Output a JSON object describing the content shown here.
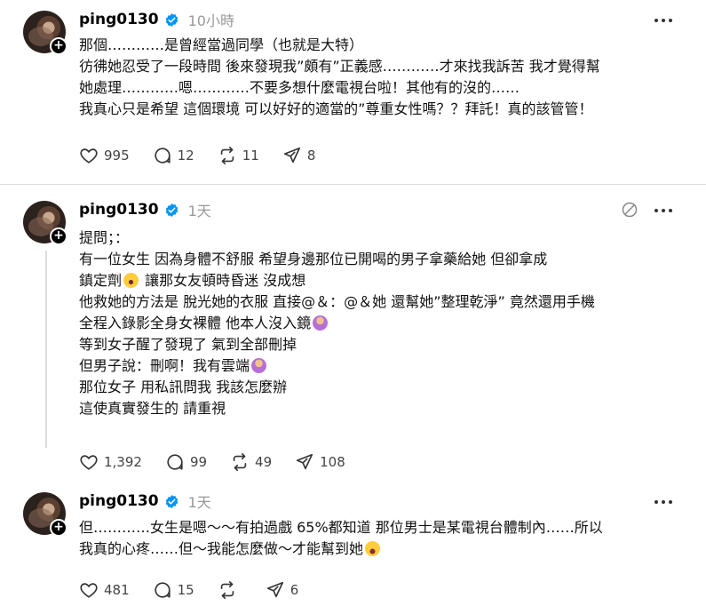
{
  "posts": [
    {
      "username": "ping0130",
      "time": "10小時",
      "lines": [
        "那個…………是曾經當過同學（也就是大特）",
        "彷彿她忍受了一段時間 後來發現我”頗有”正義感…………才來找我訴苦 我才覺得幫",
        "她處理…………嗯…………不要多想什麼電視台啦！其他有的沒的……",
        "我真心只是希望 這個環境 可以好好的適當的”尊重女性嗎？？拜託！真的該管管！"
      ],
      "stats": {
        "likes": "995",
        "replies": "12",
        "reposts": "11",
        "shares": "8"
      }
    },
    {
      "username": "ping0130",
      "time": "1天",
      "lines": [
        "提問；：",
        "有一位女生 因為身體不舒服 希望身邊那位已開喝的男子拿藥給她 但卻拿成",
        "鎮定劑",
        " 讓那女友頓時昏迷 沒成想",
        "他救她的方法是 脫光她的衣服 直接@＆：@＆她 還幫她”整理乾淨” 竟然還用手機",
        "全程入錄影全身女裸體 他本人沒入鏡",
        "等到女子醒了發現了 氣到全部刪掉",
        "但男子說：刪啊！我有雲端",
        "那位女子 用私訊問我 我該怎麼辦",
        "這使真實發生的 請重視"
      ],
      "stats": {
        "likes": "1,392",
        "replies": "99",
        "reposts": "49",
        "shares": "108"
      }
    },
    {
      "username": "ping0130",
      "time": "1天",
      "lines": [
        "但…………女生是嗯～～有拍過戲 65%都知道 那位男士是某電視台體制內……所以",
        "我真的心疼……但～我能怎麼做～才能幫到她"
      ],
      "stats": {
        "likes": "481",
        "replies": "15",
        "reposts": "",
        "shares": "6"
      }
    }
  ],
  "icons": {
    "like": "heart-icon",
    "reply": "comment-icon",
    "repost": "repost-icon",
    "share": "share-icon",
    "verified": "verified-badge-icon",
    "more": "more-icon",
    "mute": "mute-icon"
  },
  "colors": {
    "verified": "#0095f6",
    "muted_text": "#999999",
    "divider": "#dcdcdc"
  }
}
